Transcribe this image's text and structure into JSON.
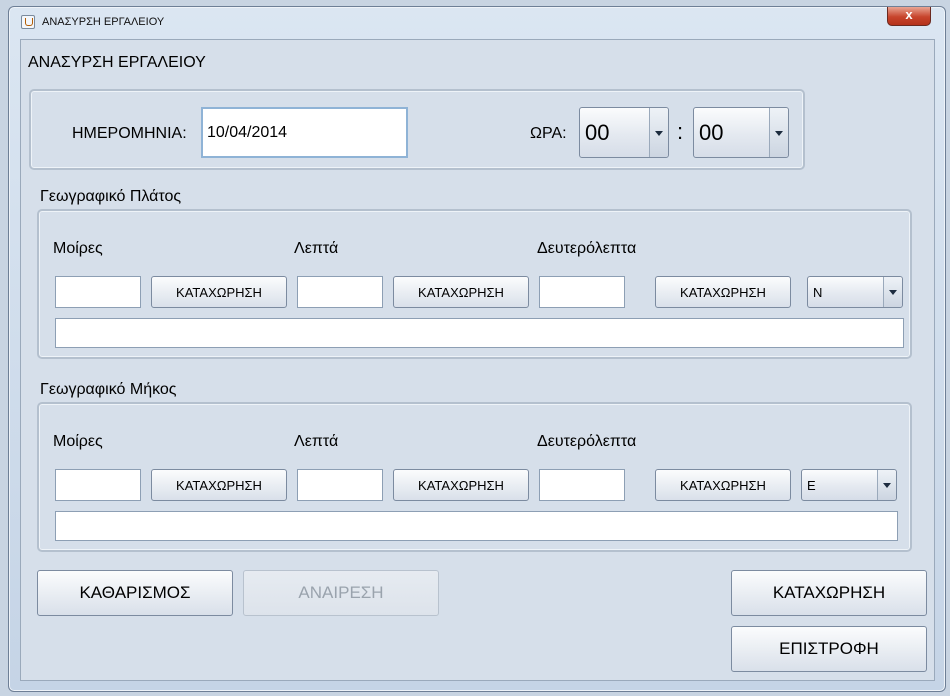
{
  "window": {
    "title": "ΑΝΑΣΥΡΣΗ ΕΡΓΑΛΕΙΟΥ",
    "close_glyph": "x"
  },
  "form": {
    "heading": "ΑΝΑΣΥΡΣΗ ΕΡΓΑΛΕΙΟΥ",
    "date_label": "ΗΜΕΡΟΜΗΝΙΑ:",
    "date_value": "10/04/2014",
    "time_label": "ΩΡΑ:",
    "hour_value": "00",
    "time_separator": ":",
    "minute_value": "00"
  },
  "latitude": {
    "title": "Γεωγραφικό Πλάτος",
    "degrees_label": "Μοίρες",
    "minutes_label": "Λεπτά",
    "seconds_label": "Δευτερόλεπτα",
    "degrees_value": "",
    "minutes_value": "",
    "seconds_value": "",
    "register_label": "ΚΑΤΑΧΩΡΗΣΗ",
    "hemisphere_value": "N",
    "result_value": ""
  },
  "longitude": {
    "title": "Γεωγραφικό Μήκος",
    "degrees_label": "Μοίρες",
    "minutes_label": "Λεπτά",
    "seconds_label": "Δευτερόλεπτα",
    "degrees_value": "",
    "minutes_value": "",
    "seconds_value": "",
    "register_label": "ΚΑΤΑΧΩΡΗΣΗ",
    "hemisphere_value": "E",
    "result_value": ""
  },
  "actions": {
    "clear_label": "ΚΑΘΑΡΙΣΜΟΣ",
    "undo_label": "ΑΝΑΙΡΕΣΗ",
    "register_label": "ΚΑΤΑΧΩΡΗΣΗ",
    "back_label": "ΕΠΙΣΤΡΟΦΗ"
  }
}
